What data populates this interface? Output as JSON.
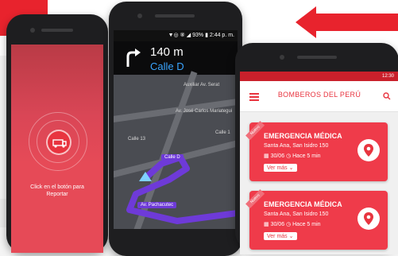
{
  "phone_nav": {
    "status_text": "▼◎ ⑧ ◢ 93% ▮ 2:44 p. m.",
    "distance": "140 m",
    "street": "Calle D",
    "map_labels": [
      "Auxiliar Av. Serat",
      "Av. José Carlos Mariategui",
      "Calle 13",
      "Calle 1",
      "Calle D",
      "Av. Pachacutec"
    ]
  },
  "phone_alert": {
    "instruction": "Click en el botón para Reportar"
  },
  "phone_feed": {
    "status_time": "12:30",
    "title": "BOMBEROS DEL PERÚ",
    "cards": [
      {
        "tag": "Nuevo",
        "title": "EMERGENCIA MÉDICA",
        "address": "Santa Ana, San Isidro 150",
        "date": "30/06",
        "ago": "Hace 5 min",
        "more": "Ver más"
      },
      {
        "tag": "Nuevo",
        "title": "EMERGENCIA MÉDICA",
        "address": "Santa Ana, San Isidro 150",
        "date": "30/06",
        "ago": "Hace 5 min",
        "more": "Ver más"
      }
    ]
  },
  "colors": {
    "brand_red": "#e8343f",
    "route_purple": "#6e3ad8"
  }
}
